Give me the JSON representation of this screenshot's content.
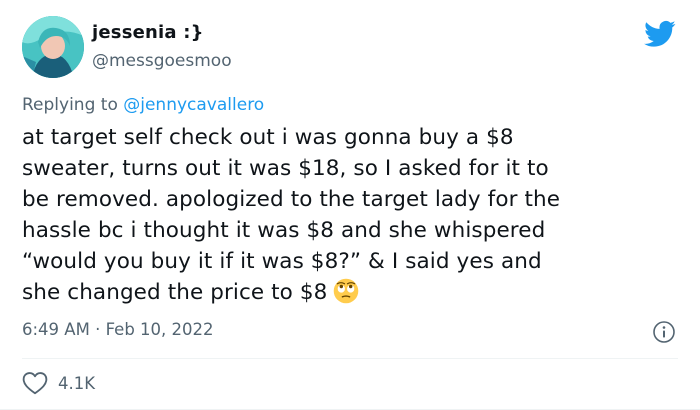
{
  "author": {
    "display_name": "jessenia :}",
    "handle": "@messgoesmoo"
  },
  "reply": {
    "prefix": "Replying to ",
    "mention": "@jennycavallero"
  },
  "tweet": {
    "lines": [
      "at target self check out i was gonna buy a $8",
      "sweater, turns out it was $18, so I asked for it to",
      "be removed. apologized to the target lady for the",
      "hassle bc i thought it was $8 and she whispered",
      "“would you buy it if it was $8?” & I said yes and",
      "she changed the price to $8"
    ],
    "emoji": "eye-roll-emoji"
  },
  "meta": {
    "time": "6:49 AM",
    "separator": " · ",
    "date": "Feb 10, 2022"
  },
  "engagement": {
    "likes": "4.1K"
  },
  "icons": {
    "brand": "twitter-bird-icon",
    "info": "info-icon",
    "like": "heart-icon"
  },
  "colors": {
    "twitter_blue": "#1d9bf0",
    "secondary_text": "#536471",
    "primary_text": "#0f1419"
  }
}
